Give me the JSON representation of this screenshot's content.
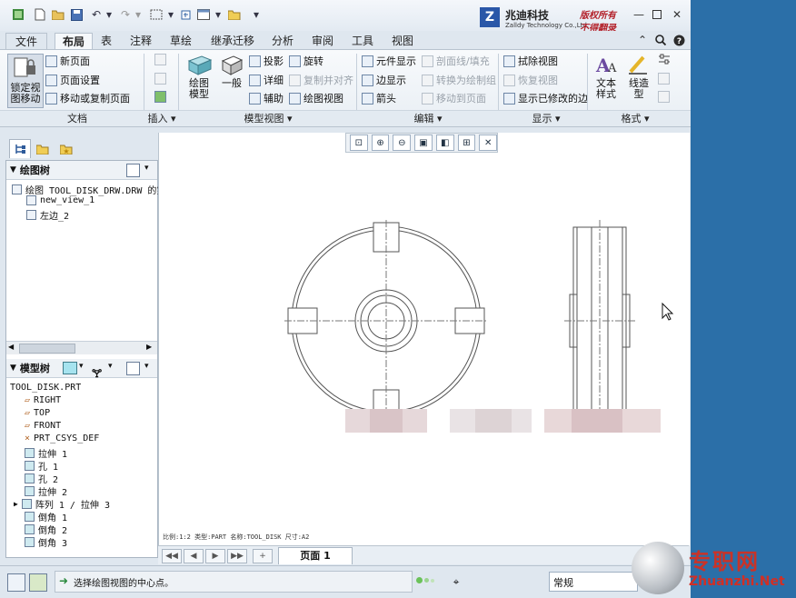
{
  "titlebar": {
    "brand_cn": "兆迪科技",
    "brand_en": "Zalldy Technology Co.,Ltd.",
    "copy_line1": "版权所有",
    "copy_line2": "不得翻录"
  },
  "tabs": [
    "文件",
    "布局",
    "表",
    "注释",
    "草绘",
    "继承迁移",
    "分析",
    "审阅",
    "工具",
    "视图"
  ],
  "active_tab": "布局",
  "ribbon": {
    "lock_label_1": "锁定视",
    "lock_label_2": "图移动",
    "new_page": "新页面",
    "page_setup": "页面设置",
    "move_copy_page": "移动或复制页面",
    "group_doc": "文档",
    "group_insert": "插入",
    "drawing_model_1": "绘图",
    "drawing_model_2": "模型",
    "general": "一般",
    "projection": "投影",
    "detailed": "详细",
    "auxiliary": "辅助",
    "revolve": "旋转",
    "copy_align": "复制并对齐",
    "drawing_view": "绘图视图",
    "group_model_views": "模型视图",
    "element_display": "元件显示",
    "edge_display": "边显示",
    "arrow": "箭头",
    "hatch_fill": "剖面线/填充",
    "convert_to_draw": "转换为绘制组",
    "move_to_page": "移动到页面",
    "group_edit": "编辑",
    "erase_view": "拭除视图",
    "restore_view": "恢复视图",
    "show_modified_edges": "显示已修改的边",
    "group_display": "显示",
    "text_style_1": "文本",
    "text_style_2": "样式",
    "line_style_1": "线造",
    "line_style_2": "型",
    "group_format": "格式"
  },
  "drawing_tree": {
    "header": "绘图树",
    "root": "绘图 TOOL_DISK_DRW.DRW 的第",
    "items": [
      "new_view_1",
      "左边_2"
    ]
  },
  "model_tree": {
    "header": "模型树",
    "root": "TOOL_DISK.PRT",
    "items": [
      "RIGHT",
      "TOP",
      "FRONT",
      "PRT_CSYS_DEF",
      "拉伸 1",
      "孔 1",
      "孔 2",
      "拉伸 2",
      "阵列 1 / 拉伸 3",
      "倒角 1",
      "倒角 2",
      "倒角 3"
    ]
  },
  "canvas": {
    "footer_info": "比例:1:2    类型:PART    名称:TOOL_DISK    尺寸:A2"
  },
  "pagebar": {
    "page_tab": "页面 1"
  },
  "status": {
    "message": "选择绘图视图的中心点。",
    "filter": "常规"
  },
  "watermark": {
    "title": "专职网",
    "url": "Zhuanzhi.Net"
  }
}
